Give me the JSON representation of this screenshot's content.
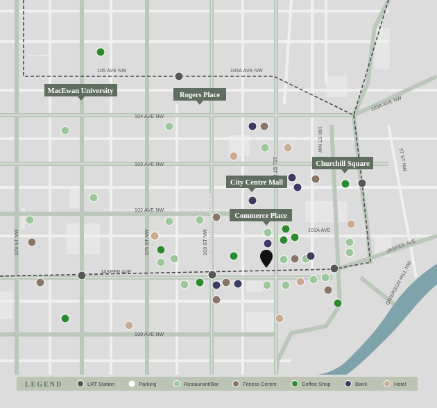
{
  "colors": {
    "background": "#dcdcdc",
    "road": "#f2f2f2",
    "major_road": "#b9c4b8",
    "river": "#7fa3ab",
    "callout": "#5f6e5f",
    "lrt_station": "#565656",
    "parking": "#ffffff",
    "restaurant_bar": "#9cc79b",
    "fitness_centre": "#8a7666",
    "coffee_shop": "#2e8a2e",
    "bank": "#3d3b62",
    "hotel": "#c9ab93"
  },
  "streets": {
    "ave_105": "105 AVE NW",
    "ave_105a": "105A AVE NW",
    "ave_104": "104 AVE NW",
    "ave_103a": "103A AVE NW",
    "ave_103": "103 AVE NW",
    "ave_102": "102 AVE NW",
    "ave_101a": "101A AVE",
    "jasper_ave": "JASPER AVE",
    "jasper_ave_east": "JASPER AVE",
    "ave_100": "100 AVE NW",
    "st_109": "109 ST NW",
    "st_105": "105 ST NW",
    "st_103": "103 ST NW",
    "st_101": "101 ST NW",
    "st_100": "100 ST NW",
    "st_97": "97 ST NW",
    "grierson_hill": "GRIERSON HILL NW"
  },
  "callouts": {
    "macewan": "MacEwan University",
    "rogers": "Rogers Place",
    "churchill": "Churchill Square",
    "city_centre": "City Centre Mall",
    "commerce": "Commerce Place"
  },
  "legend": {
    "title": "LEGEND",
    "items": [
      {
        "label": "LRT Station",
        "type": "lrt_station"
      },
      {
        "label": "Parking",
        "type": "parking"
      },
      {
        "label": "Restaurant/Bar",
        "type": "restaurant_bar"
      },
      {
        "label": "Fitness Centre",
        "type": "fitness_centre"
      },
      {
        "label": "Coffee Shop",
        "type": "coffee_shop"
      },
      {
        "label": "Bank",
        "type": "bank"
      },
      {
        "label": "Hotel",
        "type": "hotel"
      }
    ]
  },
  "markers": {
    "location_pin": "location-pin-icon"
  }
}
